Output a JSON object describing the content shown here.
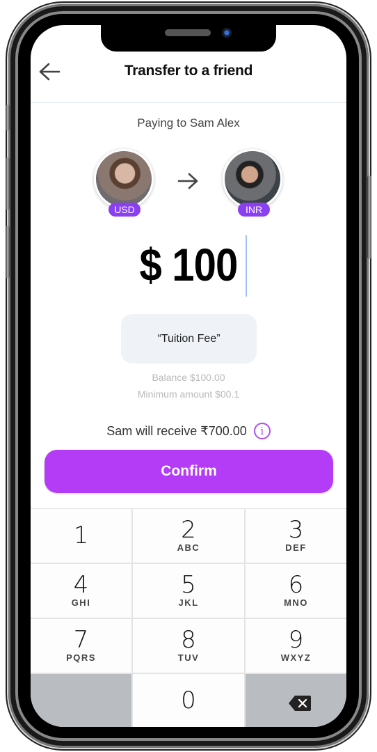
{
  "header": {
    "title": "Transfer to a friend",
    "back_icon": "arrow-left-icon"
  },
  "payee": {
    "paying_to": "Paying to Sam Alex",
    "from_currency": "USD",
    "to_currency": "INR",
    "direction_icon": "arrow-right-icon"
  },
  "amount": {
    "value": "$ 100"
  },
  "note": {
    "text": "“Tuition Fee”"
  },
  "limits": {
    "balance": "Balance $100.00",
    "minimum": "Minimum amount $00.1"
  },
  "receive": {
    "text": "Sam will receive ₹700.00",
    "info_icon": "i"
  },
  "confirm": {
    "label": "Confirm"
  },
  "colors": {
    "accent": "#b43cf7",
    "badge": "#8a3ff0",
    "info": "#b04ef0"
  },
  "keypad": {
    "keys": [
      {
        "num": "1",
        "letters": ""
      },
      {
        "num": "2",
        "letters": "ABC"
      },
      {
        "num": "3",
        "letters": "DEF"
      },
      {
        "num": "4",
        "letters": "GHI"
      },
      {
        "num": "5",
        "letters": "JKL"
      },
      {
        "num": "6",
        "letters": "MNO"
      },
      {
        "num": "7",
        "letters": "PQRS"
      },
      {
        "num": "8",
        "letters": "TUV"
      },
      {
        "num": "9",
        "letters": "WXYZ"
      },
      {
        "num": "0",
        "letters": ""
      }
    ],
    "delete_icon": "backspace-icon"
  }
}
